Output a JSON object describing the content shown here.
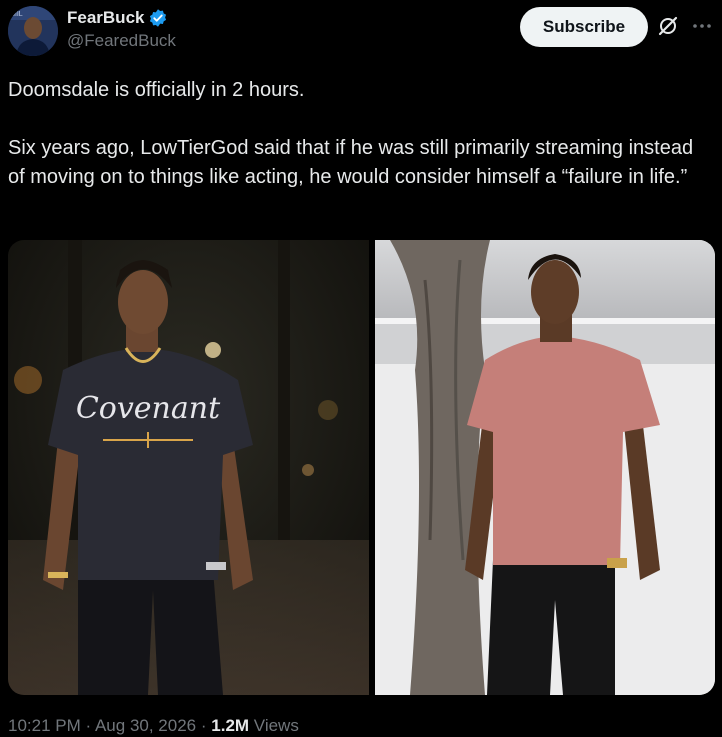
{
  "author": {
    "display_name": "FearBuck",
    "handle": "@FearedBuck",
    "verified": true,
    "verified_color": "#1d9bf0"
  },
  "actions": {
    "subscribe_label": "Subscribe",
    "grok_icon": "grok-icon",
    "more_icon": "more-options-icon"
  },
  "tweet": {
    "text": "Doomsdale is officially in 2 hours.\n\nSix years ago, LowTierGod said that if he was still primarily streaming instead of moving on to things like acting, he would consider himself a “failure in life.”"
  },
  "media": {
    "photos": [
      {
        "name": "photo-man-dark-tshirt-night",
        "shirt_text": "Covenant"
      },
      {
        "name": "photo-man-pink-tshirt-tree"
      }
    ]
  },
  "meta": {
    "time": "10:21 PM",
    "separator": "·",
    "date": "Aug 30, 2026",
    "views_count": "1.2M",
    "views_label": "Views"
  }
}
